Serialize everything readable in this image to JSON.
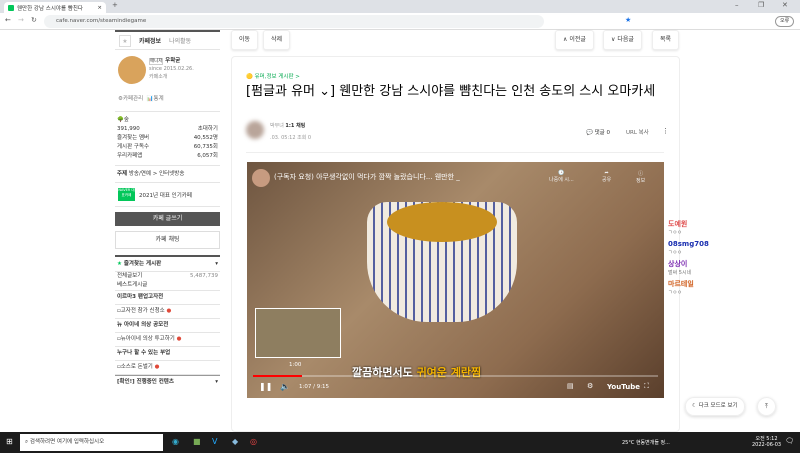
{
  "browser": {
    "tab_title": "웬만한 강남 스시야를 뺨친다",
    "url": "cafe.naver.com/steamindiegame",
    "profile_label": "오류"
  },
  "sidebar": {
    "tab_info": "카페정보",
    "tab_activity": "나의활동",
    "manager_badge": "매니저",
    "manager_name": "우왁굳",
    "since": "since 2015.02.26.",
    "intro": "카페소개",
    "admin": "카페관리",
    "stats": "통계",
    "level": "숲",
    "members": "391,990",
    "invite": "초대하기",
    "fav_members_label": "즐겨찾는 멤버",
    "fav_members": "40,552명",
    "board_subs_label": "게시판 구독수",
    "board_subs": "60,735회",
    "friend_cafe_label": "우리카페앱",
    "friend_cafe": "6,057회",
    "topic_label": "주제",
    "topic": "방송/연예 > 인터넷방송",
    "naver_badge": "NAVER 대표카페",
    "award": "2021년 대표 인기카페",
    "write_btn": "카페 글쓰기",
    "chat_btn": "카페 채팅",
    "fav_boards": "즐겨찾는 게시판",
    "items": [
      {
        "label": "전체글보기",
        "count": "5,487,739"
      },
      {
        "label": "베스트게시글"
      }
    ],
    "sections": [
      {
        "title": "이르마3 팬업고자전",
        "item": "고자전 참가 신청소"
      },
      {
        "title": "뉴 아이네 의상 공모전",
        "item": "뉴아이네 의상 투고하기"
      },
      {
        "title": "누구나 할 수 있는 부업",
        "item": "소스로 돈벌기"
      }
    ],
    "last_section": "[확인!] 진행중인 컨텐츠"
  },
  "toolbar": {
    "move": "이동",
    "delete": "삭제",
    "prev": "이전글",
    "next": "다음글",
    "list": "목록"
  },
  "article": {
    "board": "유머,정보 게시판 >",
    "title": "[펌글과 유머 ⌄] 웬만한 강남 스시야를 뺨친다는 인천 송도의 스시 오마카세",
    "author_suffix": "박부녀",
    "level": "1:1 채팅",
    "date": ".03. 05:12",
    "views": "조회 0",
    "comments": "댓글 0",
    "url_copy": "URL 복사"
  },
  "video": {
    "title": "(구독자 요청) 아무생각없이 먹다가 깜짝 놀랐습니다... 웬만한 _",
    "later": "나중에 시...",
    "share": "공유",
    "info": "정보",
    "subtitle_a": "깔끔하면서도 ",
    "subtitle_b": "귀여운 계란찜",
    "preview_time": "1:00",
    "time": "1:07 / 9:15",
    "logo": "YouTube",
    "progress": 0.12
  },
  "chat": [
    {
      "name": "도예원",
      "msg": "ㄱㅇㅇ",
      "color": "#e05050"
    },
    {
      "name": "08smg708",
      "msg": "ㄱㅇㅇ",
      "color": "#1a2fb0"
    },
    {
      "name": "상상이",
      "msg": "벌써 5시네",
      "color": "#7a2ab0"
    },
    {
      "name": "마르테일",
      "msg": "ㄱㅇㅇ",
      "color": "#d06020"
    }
  ],
  "dark_mode": "다크 모드로 보기",
  "taskbar": {
    "search": "검색하려면 여기에 입력하십시오",
    "weather": "25°C 현동변개들 정...",
    "time": "오전 5:12",
    "date": "2022-06-03"
  }
}
